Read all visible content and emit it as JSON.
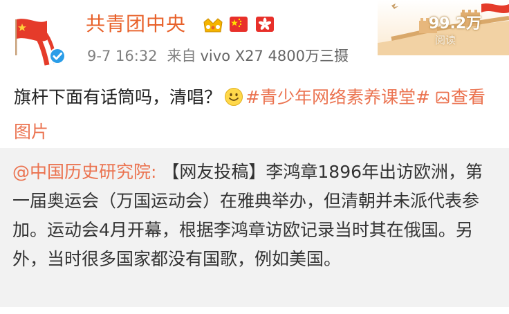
{
  "post": {
    "author": "共青团中央",
    "time": "9-7 16:32",
    "source_label": "来自",
    "source_device": "vivo X27 4800万三摄",
    "read_count": "99.2万",
    "read_label": "阅读",
    "text_main": "旗杆下面有话筒吗，清唱？",
    "hashtag": "#青少年网络素养课堂#",
    "view_images": "查看图片"
  },
  "repost": {
    "mention": "@中国历史研究院:",
    "text": " 【网友投稿】李鸿章1896年出访欧洲，第一届奥运会（万国运动会）在雅典举办，但清朝并未派代表参加。运动会4月开幕，根据李鸿章访欧记录当时其在俄国。另外，当时很多国家都没有国歌，例如美国。"
  },
  "colors": {
    "author": "#e8612a",
    "link": "#eb7350",
    "meta": "#808080",
    "repost_bg": "#f2f2f2"
  },
  "icons": [
    "avatar-flag-logo",
    "verified-icon",
    "crown-badge-icon",
    "china-flag-icon",
    "hong-kong-flag-icon",
    "great-wall-banner",
    "smile-emoji-icon",
    "picture-icon"
  ]
}
